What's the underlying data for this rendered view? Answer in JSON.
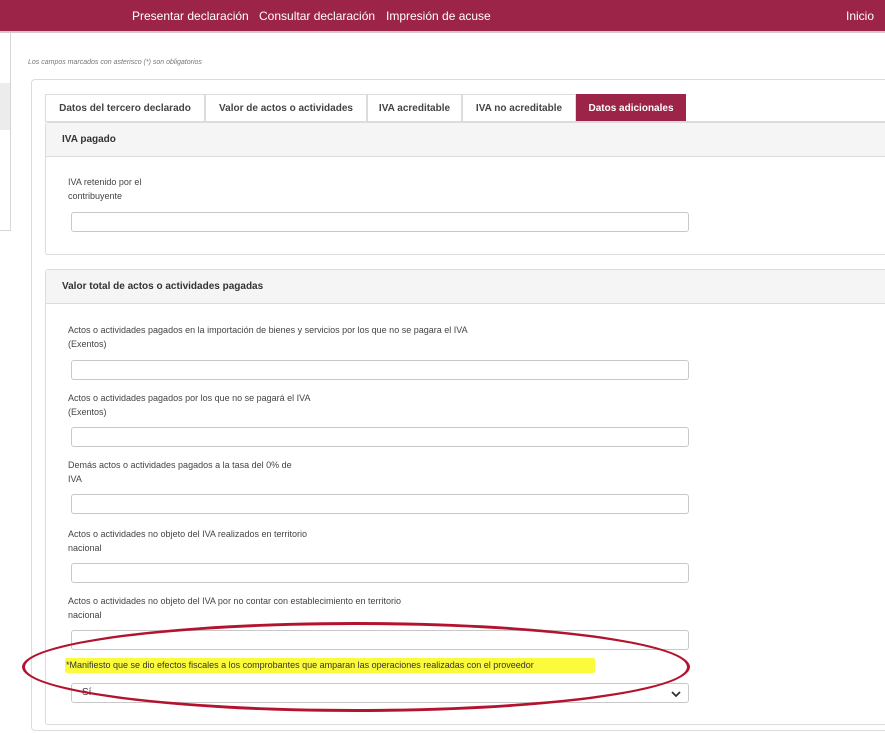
{
  "nav": {
    "items": [
      {
        "label": "Presentar declaración"
      },
      {
        "label": "Consultar declaración"
      },
      {
        "label": "Impresión de acuse"
      }
    ],
    "home": "Inicio"
  },
  "required_note": "Los campos marcados con asterisco (*) son obligatorios",
  "tabs": [
    {
      "label": "Datos del tercero declarado"
    },
    {
      "label": "Valor de actos o actividades"
    },
    {
      "label": "IVA acreditable"
    },
    {
      "label": "IVA no acreditable"
    },
    {
      "label": "Datos adicionales"
    }
  ],
  "iva_pagado": {
    "title": "IVA pagado",
    "field_label_line1": "IVA retenido por el",
    "field_label_line2": "contribuyente",
    "value": ""
  },
  "valor_total": {
    "title": "Valor total de actos o actividades pagadas",
    "fields": [
      {
        "line1": "Actos o actividades pagados en la importación de bienes y servicios por los que no se pagara el IVA",
        "line2": "(Exentos)",
        "value": ""
      },
      {
        "line1": "Actos o actividades pagados por los que no se pagará el IVA",
        "line2": "(Exentos)",
        "value": ""
      },
      {
        "line1": "Demás actos o actividades pagados a la tasa del 0% de",
        "line2": "IVA",
        "value": ""
      },
      {
        "line1": "Actos o actividades no objeto del IVA realizados en territorio",
        "line2": "nacional",
        "value": ""
      },
      {
        "line1": "Actos o actividades no objeto del IVA por no contar con establecimiento en territorio",
        "line2": "nacional",
        "value": ""
      }
    ],
    "manifiesto_label": "*Manifiesto que se dio efectos fiscales a los comprobantes que amparan las operaciones realizadas con el proveedor",
    "manifiesto_value": "Sí"
  },
  "colors": {
    "brand": "#9d2449",
    "highlight": "#fbfb3c",
    "annotation": "#b3132e"
  }
}
